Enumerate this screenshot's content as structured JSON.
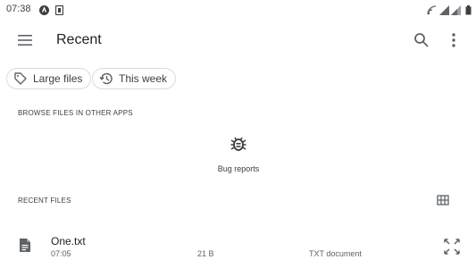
{
  "status_bar": {
    "time": "07:38",
    "icons": [
      "notification-icon",
      "sim-icon",
      "cast-icon",
      "wifi-icon",
      "signal-icon",
      "battery-icon"
    ]
  },
  "app_bar": {
    "title": "Recent",
    "icons": [
      "menu-icon",
      "search-icon",
      "more-vert-icon"
    ]
  },
  "filters": [
    {
      "label": "Large files",
      "icon": "tag-icon"
    },
    {
      "label": "This week",
      "icon": "history-icon"
    }
  ],
  "browse_section": {
    "heading": "BROWSE FILES IN OTHER APPS",
    "apps": [
      {
        "label": "Bug reports",
        "icon": "bug-icon"
      }
    ]
  },
  "recent_section": {
    "heading": "RECENT FILES",
    "view_toggle_icon": "grid-view-icon",
    "files": [
      {
        "name": "One.txt",
        "time": "07:05",
        "size": "21 B",
        "type": "TXT document",
        "icon": "text-file-icon"
      }
    ]
  },
  "colors": {
    "icon": "#5f6368",
    "text": "#202124",
    "chip_border": "#dadce0"
  }
}
